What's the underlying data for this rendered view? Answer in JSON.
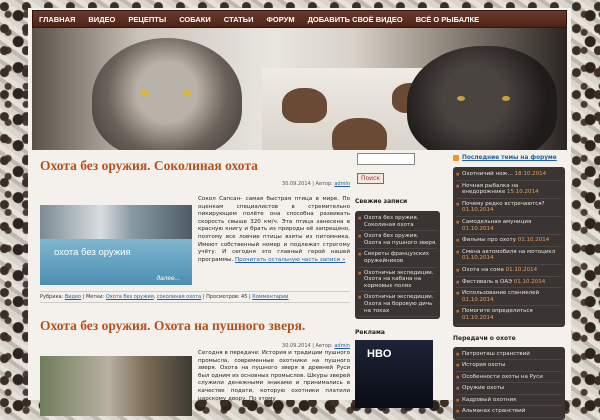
{
  "nav": [
    "Главная",
    "Видео",
    "Рецепты",
    "Собаки",
    "Статьи",
    "Форум",
    "Добавить своё видео",
    "Всё о рыбалке"
  ],
  "posts": [
    {
      "title": "Охота без оружия. Соколиная охота",
      "meta": {
        "date_prefix": "30.09.2014 | Автор: ",
        "author": "admin"
      },
      "thumb_text": "охота без оружия",
      "thumb_more": "далее...",
      "excerpt": "Сокол Сапсан- самая быстрая птица в мире. По оценкам специалистов в стремительно пикирующем полёте она способна развивать скорость свыше 320 км/ч. Эта птица занесена в красную книгу и брать из природы её запрещено, поэтому все ловчие птицы взяты из питомника. Имеют собственный номер и подлежат строгому учёту. И сегодня это главный герой нашей программы.",
      "more": "Прочитать остальную часть записи »",
      "footer": {
        "rubric_label": "Рубрика: ",
        "rubric": "Видео",
        "tags_label": " | Метки: ",
        "tags": [
          "Охота без оружия",
          "соколиная охота"
        ],
        "views": " | Просмотров: 45 | ",
        "comments": "Комментарии"
      }
    },
    {
      "title": "Охота без оружия. Охота на пушного зверя.",
      "meta": {
        "date_prefix": "30.09.2014 | Автор: ",
        "author": "admin"
      },
      "excerpt": "Сегодня в передаче: История и традиции пушного промысла, современные охотники на пушного зверя. Охота на пушного зверя в древней Руси был одним из основных промыслов. Шкуры зверей служили денежными знаками и принимались в качестве подати, которую охотники платили царскому двору. По этому"
    }
  ],
  "sidebar": {
    "search_button": "Поиск",
    "fresh_title": "Свежие записи",
    "fresh": [
      "Охота без оружия. Соколиная охота",
      "Охота без оружия. Охота на пушного зверя.",
      "Секреты французских оружейников",
      "Охотничьи экспедиции. Охота на кабана на кормовых полях",
      "Охотничьи экспедиции. Охота на боровую дичь на токах"
    ],
    "ad_title": "Реклама",
    "ad_logo": "HBO"
  },
  "right": {
    "feed_title": "Последние темы на форуме",
    "topics": [
      {
        "t": "Охотничий нож…",
        "d": "18.10.2014"
      },
      {
        "t": "Ночная рыбалка на енедорожнике",
        "d": "15.10.2014"
      },
      {
        "t": "Почему редко встречаются?",
        "d": "01.10.2014"
      },
      {
        "t": "Самодельная амуниция",
        "d": "01.10.2014"
      },
      {
        "t": "Фильмы про охоту",
        "d": "01.10.2014"
      },
      {
        "t": "Смена автомобиля на мотоцикл",
        "d": "01.10.2014"
      },
      {
        "t": "Охота на сома",
        "d": "01.10.2014"
      },
      {
        "t": "Фестиваль в ОАЭ",
        "d": "01.10.2014"
      },
      {
        "t": "Использование спаниелей",
        "d": "01.10.2014"
      },
      {
        "t": "Помогите определиться",
        "d": "01.10.2014"
      }
    ],
    "shows_title": "Передачи о охоте",
    "shows": [
      "Патронташ странствий",
      "История охоты",
      "Особенности охоты на Руси",
      "Оружие охоты",
      "Кадровый охотник",
      "Альманах странствий"
    ]
  }
}
